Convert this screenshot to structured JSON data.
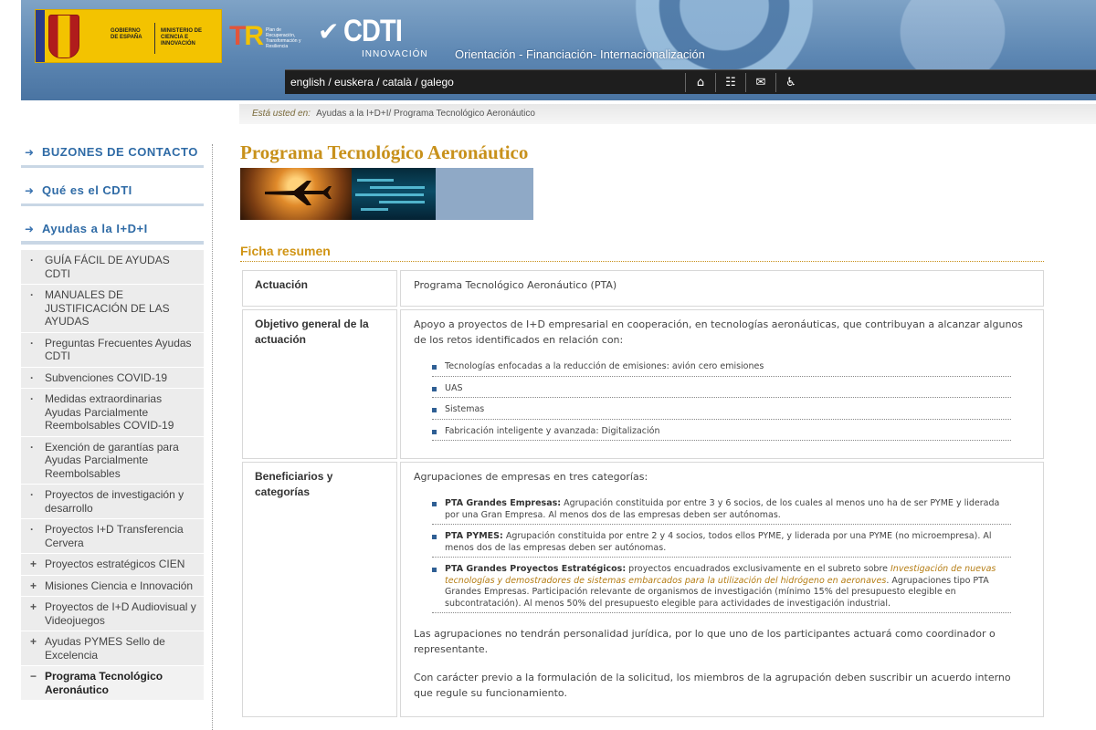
{
  "header": {
    "gov_left": "GOBIERNO DE ESPAÑA",
    "gov_right": "MINISTERIO DE CIENCIA E INNOVACIÓN",
    "prtr_small": "Plan de Recuperación, Transformación y Resiliencia",
    "cdti_word": "CDTI",
    "cdti_sub": "INNOVACIÓN",
    "tagline": "Orientación - Financiación- Internacionalización",
    "languages": [
      "english",
      "euskera",
      "català",
      "galego"
    ],
    "lang_sep": " / ",
    "icons": [
      "home-icon",
      "sitemap-icon",
      "mail-icon",
      "accessibility-icon"
    ]
  },
  "breadcrumb": {
    "label": "Está usted en:",
    "items": [
      "Ayudas a la I+D+I/",
      "Programa Tecnológico Aeronáutico"
    ]
  },
  "sidebar": {
    "sections": [
      "BUZONES DE CONTACTO",
      "Qué es el CDTI",
      "Ayudas a la I+D+I"
    ],
    "items": [
      {
        "bullet": "·",
        "label": "GUÍA FÁCIL DE AYUDAS CDTI"
      },
      {
        "bullet": "·",
        "label": "MANUALES DE JUSTIFICACIÓN DE LAS AYUDAS"
      },
      {
        "bullet": "·",
        "label": "Preguntas Frecuentes Ayudas CDTI"
      },
      {
        "bullet": "·",
        "label": "Subvenciones COVID-19"
      },
      {
        "bullet": "·",
        "label": "Medidas extraordinarias Ayudas Parcialmente Reembolsables COVID-19"
      },
      {
        "bullet": "·",
        "label": "Exención de garantías para Ayudas Parcialmente Reembolsables"
      },
      {
        "bullet": "·",
        "label": "Proyectos de investigación y desarrollo"
      },
      {
        "bullet": "·",
        "label": "Proyectos I+D Transferencia Cervera"
      },
      {
        "bullet": "+",
        "label": "Proyectos estratégicos CIEN"
      },
      {
        "bullet": "+",
        "label": "Misiones Ciencia e Innovación"
      },
      {
        "bullet": "+",
        "label": "Proyectos de I+D Audiovisual y Videojuegos"
      },
      {
        "bullet": "+",
        "label": "Ayudas PYMES Sello de Excelencia"
      },
      {
        "bullet": "−",
        "label": "Programa Tecnológico Aeronáutico"
      }
    ]
  },
  "main": {
    "title": "Programa Tecnológico Aeronáutico",
    "ficha_title": "Ficha resumen",
    "rows": [
      {
        "key": "Actuación",
        "value": "Programa Tecnológico Aeronáutico (PTA)"
      },
      {
        "key": "Objetivo general de la actuación",
        "value": "Apoyo a proyectos de I+D empresarial en cooperación, en tecnologías aeronáuticas, que contribuyan a alcanzar algunos de los retos identificados en relación con:",
        "bullets": [
          "Tecnologías enfocadas a la reducción de emisiones: avión cero emisiones",
          "UAS",
          "Sistemas",
          "Fabricación inteligente y avanzada: Digitalización"
        ]
      },
      {
        "key": "Beneficiarios y categorías",
        "value": "Agrupaciones de empresas en tres categorías:",
        "b1_head": "PTA Grandes Empresas:",
        "b1_text": " Agrupación constituida por entre 3 y 6 socios, de los cuales al menos uno ha de ser PYME y liderada por una Gran Empresa. Al menos dos de las empresas deben ser autónomas.",
        "b2_head": "PTA PYMES:",
        "b2_text": " Agrupación constituida por entre 2 y 4 socios, todos ellos PYME, y liderada por una PYME (no microempresa). Al menos dos de las empresas deben ser autónomas.",
        "b3_head": "PTA Grandes Proyectos Estratégicos:",
        "b3_text1": " proyectos encuadrados exclusivamente en el subreto sobre ",
        "b3_italic": "Investigación de nuevas tecnologías y demostradores de sistemas embarcados para la utilización del hidrógeno en aeronaves",
        "b3_text2": ". Agrupaciones tipo PTA Grandes Empresas. Participación relevante de organismos de investigación (mínimo 15% del presupuesto elegible en subcontratación). Al menos 50% del presupuesto elegible para actividades de investigación industrial.",
        "p1": "Las agrupaciones no tendrán personalidad jurídica, por lo que uno de los participantes actuará como coordinador o representante.",
        "p2": "Con carácter previo a la formulación de la solicitud, los miembros de la agrupación deben suscribir un acuerdo interno que regule su funcionamiento."
      }
    ]
  }
}
